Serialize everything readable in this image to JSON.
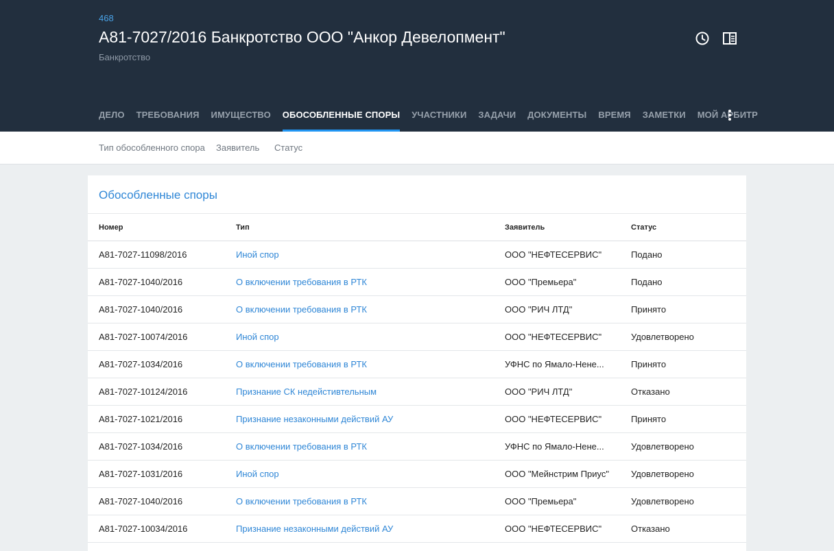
{
  "header": {
    "case_id": "468",
    "title": "А81-7027/2016 Банкротство ООО \"Анкор Девелопмент\"",
    "subtitle": "Банкротство",
    "icons": [
      "history-clock-icon",
      "side-panel-icon",
      "more-vertical-icon"
    ]
  },
  "nav": {
    "tabs": [
      {
        "label": "ДЕЛО"
      },
      {
        "label": "ТРЕБОВАНИЯ"
      },
      {
        "label": "ИМУЩЕСТВО"
      },
      {
        "label": "ОБОСОБЛЕННЫЕ СПОРЫ",
        "active": true
      },
      {
        "label": "УЧАСТНИКИ"
      },
      {
        "label": "ЗАДАЧИ"
      },
      {
        "label": "ДОКУМЕНТЫ"
      },
      {
        "label": "ВРЕМЯ"
      },
      {
        "label": "ЗАМЕТКИ"
      },
      {
        "label": "МОЙ АРБИТР"
      }
    ]
  },
  "filters": {
    "type": "Тип обособленного спора",
    "applicant": "Заявитель",
    "status": "Статус"
  },
  "card": {
    "title": "Обособленные споры"
  },
  "table": {
    "headers": {
      "number": "Номер",
      "type": "Тип",
      "applicant": "Заявитель",
      "status": "Статус"
    },
    "rows": [
      {
        "number": "А81-7027-11098/2016",
        "type": "Иной спор",
        "applicant": "ООО \"НЕФТЕСЕРВИС\"",
        "status": "Подано"
      },
      {
        "number": "А81-7027-1040/2016",
        "type": "О включении требования в РТК",
        "applicant": "ООО \"Премьера\"",
        "status": "Подано"
      },
      {
        "number": "А81-7027-1040/2016",
        "type": "О включении требования в РТК",
        "applicant": "ООО \"РИЧ ЛТД\"",
        "status": "Принято"
      },
      {
        "number": "А81-7027-10074/2016",
        "type": "Иной спор",
        "applicant": "ООО \"НЕФТЕСЕРВИС\"",
        "status": "Удовлетворено"
      },
      {
        "number": "А81-7027-1034/2016",
        "type": "О включении требования в РТК",
        "applicant": "УФНС по Ямало-Нене...",
        "status": "Принято"
      },
      {
        "number": "А81-7027-10124/2016",
        "type": "Признание СК недейстивтельным",
        "applicant": "ООО \"РИЧ ЛТД\"",
        "status": "Отказано"
      },
      {
        "number": "А81-7027-1021/2016",
        "type": "Признание незаконными действий АУ",
        "applicant": "ООО \"НЕФТЕСЕРВИС\"",
        "status": "Принято"
      },
      {
        "number": "А81-7027-1034/2016",
        "type": "О включении требования в РТК",
        "applicant": "УФНС по Ямало-Нене...",
        "status": "Удовлетворено"
      },
      {
        "number": "А81-7027-1031/2016",
        "type": "Иной спор",
        "applicant": "ООО \"Мейнстрим Приус\"",
        "status": "Удовлетворено"
      },
      {
        "number": "А81-7027-1040/2016",
        "type": "О включении требования в РТК",
        "applicant": "ООО \"Премьера\"",
        "status": "Удовлетворено"
      },
      {
        "number": "А81-7027-10034/2016",
        "type": "Признание незаконными действий АУ",
        "applicant": "ООО \"НЕФТЕСЕРВИС\"",
        "status": "Отказано"
      }
    ]
  },
  "colors": {
    "header_bg": "#222f3e",
    "accent": "#2196f3",
    "link": "#2e86d6",
    "page_bg": "#eceff1"
  }
}
